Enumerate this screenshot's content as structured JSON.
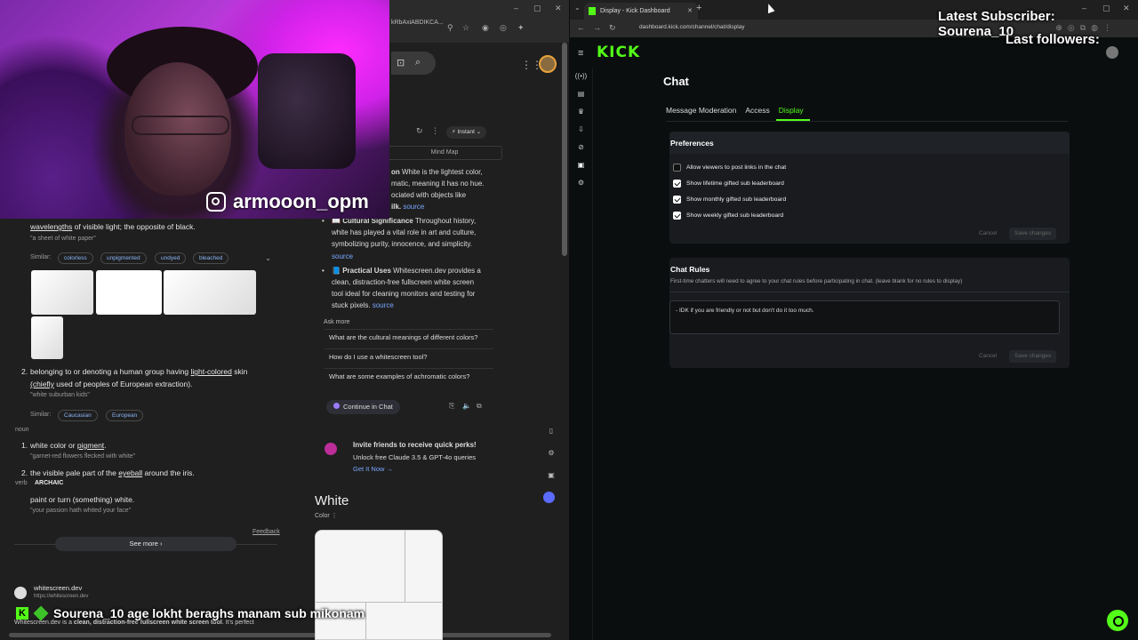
{
  "left_browser": {
    "url_fragment": "https://www.google.com/search?q=white&sca_esv=...&sxsrf=ADLYWIKRKtAB6w8rAxiABDIKCA...",
    "url_short": "kRbAxiABDIKCA...",
    "search_icons": [
      "lens-icon",
      "search-icon"
    ]
  },
  "webcam": {
    "instagram_handle": "armooon_opm"
  },
  "dictionary": {
    "def1_rest": "wavelengths of visible light; the opposite of black.",
    "def1_link": "wavelengths",
    "def1_tail": " of visible light; the opposite of black.",
    "def1_example": "\"a sheet of white paper\"",
    "similar_label": "Similar:",
    "similar1": [
      "colorless",
      "unpigmented",
      "undyed",
      "bleached"
    ],
    "def2_num": "2.",
    "def2_line1_pre": "belonging to or denoting a human group having ",
    "def2_line1_link": "light-colored",
    "def2_line1_post": " skin",
    "def2_line2_link": "(chiefly",
    "def2_line2_post": " used of peoples of European extraction).",
    "def2_example": "\"white suburban kids\"",
    "similar2": [
      "Caucasian",
      "European"
    ],
    "noun_label": "noun",
    "noun_def_pre": "white color or ",
    "noun_def_link": "pigment",
    "noun_def_post": ".",
    "noun_num1": "1.",
    "noun_example": "\"garnet-red flowers flecked with white\"",
    "noun_num2": "2.",
    "noun2_pre": "the visible pale part of the ",
    "noun2_link": "eyeball",
    "noun2_post": " around the iris.",
    "verb_label": "verb",
    "archaic_label": "ARCHAIC",
    "verb_def": "paint or turn (something) white.",
    "verb_example": "\"your passion hath whited your face\"",
    "feedback": "Feedback",
    "see_more": "See more",
    "result_site": "whitescreen.dev",
    "result_url": "https://whitescreen.dev",
    "result_snippet_pre": "Whitescreen.dev is a ",
    "result_snippet_bold": "clean, distraction-free fullscreen white screen tool",
    "result_snippet_post": ". It's perfect"
  },
  "ai_panel": {
    "instant_label": "Instant",
    "mind_map": "Mind Map",
    "lines_top": [
      {
        "bold": "on",
        "text": " White is the lightest color,"
      },
      {
        "bold": "",
        "text": "matic, meaning it has no hue."
      },
      {
        "bold": "",
        "text": "ociated with objects like"
      },
      {
        "bold": "ilk.",
        "text": "",
        "src": "source"
      }
    ],
    "bullet2_title": "Cultural Significance",
    "bullet2_lines": [
      " Throughout history,",
      "white has played a vital role in art and culture,",
      "symbolizing purity, innocence, and simplicity."
    ],
    "bullet2_src": "source",
    "bullet3_title": "Practical Uses",
    "bullet3_lines": [
      " Whitescreen.dev provides a",
      "clean, distraction-free fullscreen white screen",
      "tool ideal for cleaning monitors and testing for",
      "stuck pixels."
    ],
    "bullet3_src": "source",
    "ask_more": "Ask more",
    "questions": [
      "What are the cultural meanings of different colors?",
      "How do I use a whitescreen tool?",
      "What are some examples of achromatic colors?"
    ],
    "continue_label": "Continue in Chat",
    "invite_title": "Invite friends to receive quick perks!",
    "invite_sub": "Unlock free Claude 3.5 & GPT-4o queries",
    "invite_link": "Get It Now →",
    "kp_title": "White",
    "kp_sub": "Color"
  },
  "ticker": {
    "text": "Sourena_10    age lokht beraghs manam sub mikonam"
  },
  "right_browser": {
    "tab_title": "Display - Kick Dashboard",
    "url": "dashboard.kick.com/channel/chat/display",
    "logo": "KICK"
  },
  "kick": {
    "page_title": "Chat",
    "tabs": [
      "Message Moderation",
      "Access",
      "Display"
    ],
    "active_tab": "Display",
    "preferences_title": "Preferences",
    "preferences": [
      {
        "label": "Allow viewers to post links in the chat",
        "checked": false
      },
      {
        "label": "Show lifetime gifted sub leaderboard",
        "checked": true
      },
      {
        "label": "Show monthly gifted sub leaderboard",
        "checked": true
      },
      {
        "label": "Show weekly gifted sub leaderboard",
        "checked": true
      }
    ],
    "cancel": "Cancel",
    "save": "Save changes",
    "rules_title": "Chat Rules",
    "rules_desc": "First-time chatters will need to agree to your chat rules before participating in chat. (leave blank for no rules to display)",
    "rules_value": "- IDK  if you are friendly or not but don't do it too much."
  },
  "overlay": {
    "latest_sub_label": "Latest Subscriber:",
    "latest_sub_name": "Sourena_10",
    "last_followers": "Last followers:"
  },
  "colors": {
    "kick_green": "#53fc18",
    "link_blue": "#8ab4f8"
  }
}
